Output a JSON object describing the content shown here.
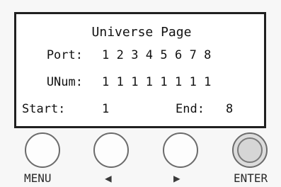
{
  "screen": {
    "title": "Universe Page",
    "port_label": "Port:",
    "port_values": [
      "1",
      "2",
      "3",
      "4",
      "5",
      "6",
      "7",
      "8"
    ],
    "unum_label": "UNum:",
    "unum_values": [
      "1",
      "1",
      "1",
      "1",
      "1",
      "1",
      "1",
      "1"
    ],
    "start_label": "Start:",
    "start_value": "1",
    "end_label": "End:",
    "end_value": "8"
  },
  "buttons": {
    "menu_label": "MENU",
    "left_label": "◀",
    "right_label": "▶",
    "enter_label": "ENTER"
  }
}
